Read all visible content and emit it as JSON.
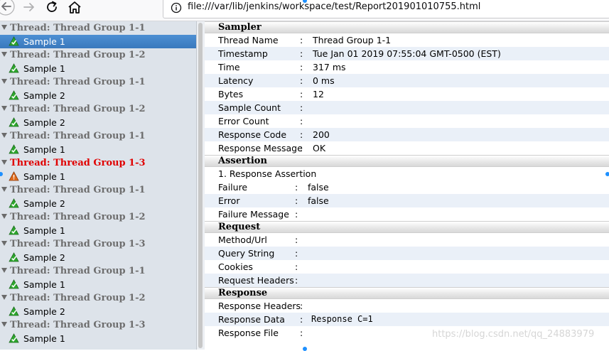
{
  "browser": {
    "url": "file:///var/lib/jenkins/workspace/test/Report201901010755.html"
  },
  "tree": [
    {
      "kind": "group",
      "label": "Thread: Thread Group 1-1",
      "status": "ok"
    },
    {
      "kind": "sample",
      "label": "Sample 1",
      "status": "ok",
      "selected": true
    },
    {
      "kind": "group",
      "label": "Thread: Thread Group 1-2",
      "status": "ok"
    },
    {
      "kind": "sample",
      "label": "Sample 1",
      "status": "ok"
    },
    {
      "kind": "group",
      "label": "Thread: Thread Group 1-1",
      "status": "ok"
    },
    {
      "kind": "sample",
      "label": "Sample 2",
      "status": "ok"
    },
    {
      "kind": "group",
      "label": "Thread: Thread Group 1-2",
      "status": "ok"
    },
    {
      "kind": "sample",
      "label": "Sample 2",
      "status": "ok"
    },
    {
      "kind": "group",
      "label": "Thread: Thread Group 1-1",
      "status": "ok"
    },
    {
      "kind": "sample",
      "label": "Sample 1",
      "status": "ok"
    },
    {
      "kind": "group",
      "label": "Thread: Thread Group 1-3",
      "status": "fail"
    },
    {
      "kind": "sample",
      "label": "Sample 1",
      "status": "fail"
    },
    {
      "kind": "group",
      "label": "Thread: Thread Group 1-1",
      "status": "ok"
    },
    {
      "kind": "sample",
      "label": "Sample 2",
      "status": "ok"
    },
    {
      "kind": "group",
      "label": "Thread: Thread Group 1-2",
      "status": "ok"
    },
    {
      "kind": "sample",
      "label": "Sample 1",
      "status": "ok"
    },
    {
      "kind": "group",
      "label": "Thread: Thread Group 1-3",
      "status": "ok"
    },
    {
      "kind": "sample",
      "label": "Sample 2",
      "status": "ok"
    },
    {
      "kind": "group",
      "label": "Thread: Thread Group 1-1",
      "status": "ok"
    },
    {
      "kind": "sample",
      "label": "Sample 1",
      "status": "ok"
    },
    {
      "kind": "group",
      "label": "Thread: Thread Group 1-2",
      "status": "ok"
    },
    {
      "kind": "sample",
      "label": "Sample 2",
      "status": "ok"
    },
    {
      "kind": "group",
      "label": "Thread: Thread Group 1-3",
      "status": "ok"
    },
    {
      "kind": "sample",
      "label": "Sample 1",
      "status": "ok"
    }
  ],
  "details": {
    "sampler": {
      "title": "Sampler",
      "rows": [
        {
          "key": "Thread Name",
          "value": "Thread Group 1-1"
        },
        {
          "key": "Timestamp",
          "value": "Tue Jan 01 2019 07:55:04 GMT-0500 (EST)"
        },
        {
          "key": "Time",
          "value": "317 ms"
        },
        {
          "key": "Latency",
          "value": "0 ms"
        },
        {
          "key": "Bytes",
          "value": "12"
        },
        {
          "key": "Sample Count",
          "value": ""
        },
        {
          "key": "Error Count",
          "value": ""
        },
        {
          "key": "Response Code",
          "value": "200"
        },
        {
          "key": "Response Message",
          "value": "OK"
        }
      ]
    },
    "assertion": {
      "title": "Assertion",
      "name": "1. Response Assertion",
      "rows": [
        {
          "key": "Failure",
          "value": "false"
        },
        {
          "key": "Error",
          "value": "false"
        },
        {
          "key": "Failure Message",
          "value": ""
        }
      ]
    },
    "request": {
      "title": "Request",
      "rows": [
        {
          "key": "Method/Url",
          "value": ""
        },
        {
          "key": "Query String",
          "value": ""
        },
        {
          "key": "Cookies",
          "value": ""
        },
        {
          "key": "Request Headers",
          "value": ""
        }
      ]
    },
    "response": {
      "title": "Response",
      "rows": [
        {
          "key": "Response Headers",
          "value": ""
        },
        {
          "key": "Response Data",
          "value": "Response C=1"
        },
        {
          "key": "Response File",
          "value": ""
        }
      ]
    },
    "separator": ":"
  },
  "watermark": "https://blog.csdn.net/qq_24883979",
  "colors": {
    "selected": "#3a79bd",
    "fail_text": "#e00000",
    "ok_icon": "#2ea82e",
    "fail_icon": "#e06a1a"
  }
}
